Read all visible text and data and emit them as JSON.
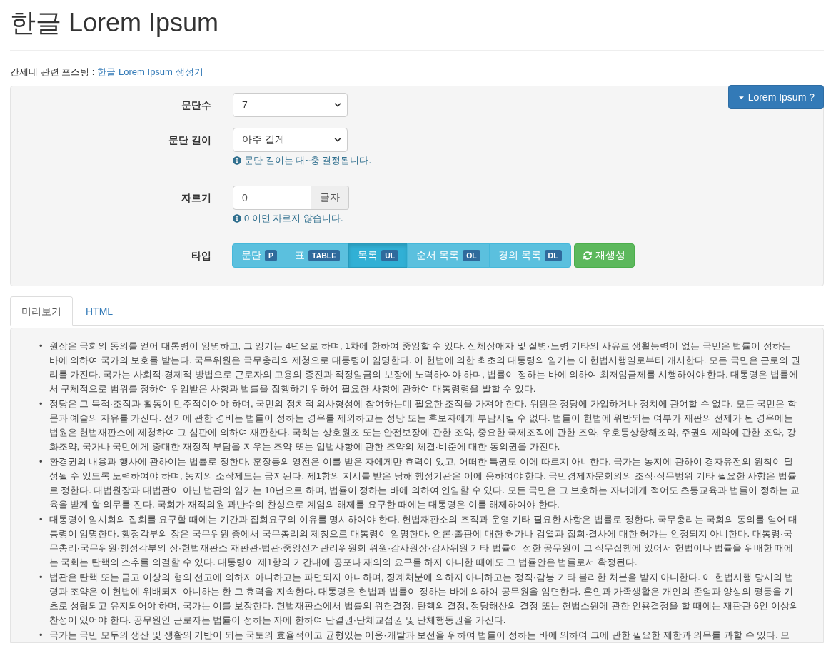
{
  "title": "한글 Lorem Ipsum",
  "related": {
    "label": "간세네 관련 포스팅 :",
    "link": "한글 Lorem Ipsum 생성기"
  },
  "help_button": {
    "label": "Lorem Ipsum ?"
  },
  "fields": [
    {
      "kind": "select",
      "label": "문단수",
      "value": "7"
    },
    {
      "kind": "select",
      "label": "문단 길이",
      "value": "아주 길게",
      "help": "문단 길이는 대~충 결정됩니다."
    },
    {
      "kind": "input",
      "label": "자르기",
      "value": "0",
      "addon": "글자",
      "help": "0 이면 자르지 않습니다."
    },
    {
      "kind": "buttons",
      "label": "타입",
      "options": [
        {
          "label": "문단",
          "tag": "P",
          "selected": false
        },
        {
          "label": "표",
          "tag": "TABLE",
          "selected": false
        },
        {
          "label": "목록",
          "tag": "UL",
          "selected": true
        },
        {
          "label": "순서 목록",
          "tag": "OL",
          "selected": false
        },
        {
          "label": "경의 목록",
          "tag": "DL",
          "selected": false
        }
      ],
      "action": "재생성"
    }
  ],
  "tabs": [
    {
      "label": "미리보기",
      "selected": true
    },
    {
      "label": "HTML",
      "selected": false
    }
  ],
  "bullet": "•",
  "items": [
    "원장은 국회의 동의를 얻어 대통령이 임명하고, 그 임기는 4년으로 하며, 1차에 한하여 중임할 수 있다. 신체장애자 및 질병·노령 기타의 사유로 생활능력이 없는 국민은 법률이 정하는 바에 의하여 국가의 보호를 받는다. 국무위원은 국무총리의 제청으로 대통령이 임명한다. 이 헌법에 의한 최초의 대통령의 임기는 이 헌법시행일로부터 개시한다. 모든 국민은 근로의 권리를 가진다. 국가는 사회적·경제적 방법으로 근로자의 고용의 증진과 적정임금의 보장에 노력하여야 하며, 법률이 정하는 바에 의하여 최저임금제를 시행하여야 한다. 대통령은 법률에서 구체적으로 범위를 정하여 위임받은 사항과 법률을 집행하기 위하여 필요한 사항에 관하여 대통령령을 발할 수 있다.",
    "정당은 그 목적·조직과 활동이 민주적이어야 하며, 국민의 정치적 의사형성에 참여하는데 필요한 조직을 가져야 한다. 위원은 정당에 가입하거나 정치에 관여할 수 없다. 모든 국민은 학문과 예술의 자유를 가진다. 선거에 관한 경비는 법률이 정하는 경우를 제외하고는 정당 또는 후보자에게 부담시킬 수 없다. 법률이 헌법에 위반되는 여부가 재판의 전제가 된 경우에는 법원은 헌법재판소에 제청하여 그 심판에 의하여 재판한다. 국회는 상호원조 또는 안전보장에 관한 조약, 중요한 국제조직에 관한 조약, 우호통상항해조약, 주권의 제약에 관한 조약, 강화조약, 국가나 국민에게 중대한 재정적 부담을 지우는 조약 또는 입법사항에 관한 조약의 체결·비준에 대한 동의권을 가진다.",
    "환경권의 내용과 행사에 관하여는 법률로 정한다. 훈장등의 영전은 이를 받은 자에게만 효력이 있고, 어떠한 특권도 이에 따르지 아니한다. 국가는 농지에 관하여 경자유전의 원칙이 달성될 수 있도록 노력하여야 하며, 농지의 소작제도는 금지된다. 제1항의 지시를 받은 당해 행정기관은 이에 응하여야 한다. 국민경제자문회의의 조직·직무범위 기타 필요한 사항은 법률로 정한다. 대법원장과 대법관이 아닌 법관의 임기는 10년으로 하며, 법률이 정하는 바에 의하여 연임할 수 있다. 모든 국민은 그 보호하는 자녀에게 적어도 초등교육과 법률이 정하는 교육을 받게 할 의무를 진다. 국회가 재적의원 과반수의 찬성으로 계엄의 해제를 요구한 때에는 대통령은 이를 해제하여야 한다.",
    "대통령이 임시회의 집회를 요구할 때에는 기간과 집회요구의 이유를 명시하여야 한다. 헌법재판소의 조직과 운영 기타 필요한 사항은 법률로 정한다. 국무총리는 국회의 동의를 얻어 대통령이 임명한다. 행정각부의 장은 국무위원 중에서 국무총리의 제청으로 대통령이 임명한다. 언론·출판에 대한 허가나 검열과 집회·결사에 대한 허가는 인정되지 아니한다. 대통령·국무총리·국무위원·행정각부의 장·헌법재판소 재판관·법관·중앙선거관리위원회 위원·감사원장·감사위원 기타 법률이 정한 공무원이 그 직무집행에 있어서 헌법이나 법률을 위배한 때에는 국회는 탄핵의 소추를 의결할 수 있다. 대통령이 제1항의 기간내에 공포나 재의의 요구를 하지 아니한 때에도 그 법률안은 법률로서 확정된다.",
    "법관은 탄핵 또는 금고 이상의 형의 선고에 의하지 아니하고는 파면되지 아니하며, 징계처분에 의하지 아니하고는 정직·감봉 기타 불리한 처분을 받지 아니한다. 이 헌법시행 당시의 법령과 조약은 이 헌법에 위배되지 아니하는 한 그 효력을 지속한다. 대통령은 헌법과 법률이 정하는 바에 의하여 공무원을 임면한다. 혼인과 가족생활은 개인의 존엄과 양성의 평등을 기초로 성립되고 유지되어야 하며, 국가는 이를 보장한다. 헌법재판소에서 법률의 위헌결정, 탄핵의 결정, 정당해산의 결정 또는 헌법소원에 관한 인용결정을 할 때에는 재판관 6인 이상의 찬성이 있어야 한다. 공무원인 근로자는 법률이 정하는 자에 한하여 단결권·단체교섭권 및 단체행동권을 가진다.",
    "국가는 국민 모두의 생산 및 생활의 기반이 되는 국토의 효율적이고 균형있는 이용·개발과 보전을 위하여 법률이 정하는 바에 의하여 그에 관한 필요한 제한과 의무를 과할 수 있다. 모"
  ]
}
